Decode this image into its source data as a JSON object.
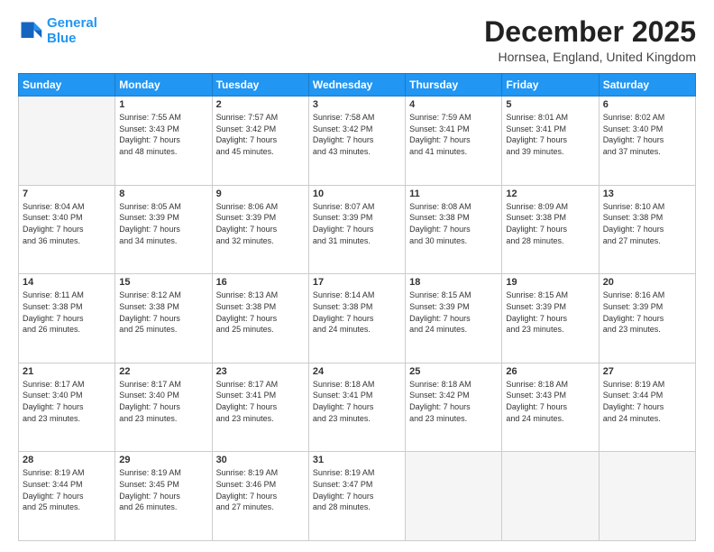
{
  "header": {
    "logo_line1": "General",
    "logo_line2": "Blue",
    "title": "December 2025",
    "subtitle": "Hornsea, England, United Kingdom"
  },
  "calendar": {
    "days_of_week": [
      "Sunday",
      "Monday",
      "Tuesday",
      "Wednesday",
      "Thursday",
      "Friday",
      "Saturday"
    ],
    "weeks": [
      [
        {
          "day": "",
          "info": ""
        },
        {
          "day": "1",
          "info": "Sunrise: 7:55 AM\nSunset: 3:43 PM\nDaylight: 7 hours\nand 48 minutes."
        },
        {
          "day": "2",
          "info": "Sunrise: 7:57 AM\nSunset: 3:42 PM\nDaylight: 7 hours\nand 45 minutes."
        },
        {
          "day": "3",
          "info": "Sunrise: 7:58 AM\nSunset: 3:42 PM\nDaylight: 7 hours\nand 43 minutes."
        },
        {
          "day": "4",
          "info": "Sunrise: 7:59 AM\nSunset: 3:41 PM\nDaylight: 7 hours\nand 41 minutes."
        },
        {
          "day": "5",
          "info": "Sunrise: 8:01 AM\nSunset: 3:41 PM\nDaylight: 7 hours\nand 39 minutes."
        },
        {
          "day": "6",
          "info": "Sunrise: 8:02 AM\nSunset: 3:40 PM\nDaylight: 7 hours\nand 37 minutes."
        }
      ],
      [
        {
          "day": "7",
          "info": "Sunrise: 8:04 AM\nSunset: 3:40 PM\nDaylight: 7 hours\nand 36 minutes."
        },
        {
          "day": "8",
          "info": "Sunrise: 8:05 AM\nSunset: 3:39 PM\nDaylight: 7 hours\nand 34 minutes."
        },
        {
          "day": "9",
          "info": "Sunrise: 8:06 AM\nSunset: 3:39 PM\nDaylight: 7 hours\nand 32 minutes."
        },
        {
          "day": "10",
          "info": "Sunrise: 8:07 AM\nSunset: 3:39 PM\nDaylight: 7 hours\nand 31 minutes."
        },
        {
          "day": "11",
          "info": "Sunrise: 8:08 AM\nSunset: 3:38 PM\nDaylight: 7 hours\nand 30 minutes."
        },
        {
          "day": "12",
          "info": "Sunrise: 8:09 AM\nSunset: 3:38 PM\nDaylight: 7 hours\nand 28 minutes."
        },
        {
          "day": "13",
          "info": "Sunrise: 8:10 AM\nSunset: 3:38 PM\nDaylight: 7 hours\nand 27 minutes."
        }
      ],
      [
        {
          "day": "14",
          "info": "Sunrise: 8:11 AM\nSunset: 3:38 PM\nDaylight: 7 hours\nand 26 minutes."
        },
        {
          "day": "15",
          "info": "Sunrise: 8:12 AM\nSunset: 3:38 PM\nDaylight: 7 hours\nand 25 minutes."
        },
        {
          "day": "16",
          "info": "Sunrise: 8:13 AM\nSunset: 3:38 PM\nDaylight: 7 hours\nand 25 minutes."
        },
        {
          "day": "17",
          "info": "Sunrise: 8:14 AM\nSunset: 3:38 PM\nDaylight: 7 hours\nand 24 minutes."
        },
        {
          "day": "18",
          "info": "Sunrise: 8:15 AM\nSunset: 3:39 PM\nDaylight: 7 hours\nand 24 minutes."
        },
        {
          "day": "19",
          "info": "Sunrise: 8:15 AM\nSunset: 3:39 PM\nDaylight: 7 hours\nand 23 minutes."
        },
        {
          "day": "20",
          "info": "Sunrise: 8:16 AM\nSunset: 3:39 PM\nDaylight: 7 hours\nand 23 minutes."
        }
      ],
      [
        {
          "day": "21",
          "info": "Sunrise: 8:17 AM\nSunset: 3:40 PM\nDaylight: 7 hours\nand 23 minutes."
        },
        {
          "day": "22",
          "info": "Sunrise: 8:17 AM\nSunset: 3:40 PM\nDaylight: 7 hours\nand 23 minutes."
        },
        {
          "day": "23",
          "info": "Sunrise: 8:17 AM\nSunset: 3:41 PM\nDaylight: 7 hours\nand 23 minutes."
        },
        {
          "day": "24",
          "info": "Sunrise: 8:18 AM\nSunset: 3:41 PM\nDaylight: 7 hours\nand 23 minutes."
        },
        {
          "day": "25",
          "info": "Sunrise: 8:18 AM\nSunset: 3:42 PM\nDaylight: 7 hours\nand 23 minutes."
        },
        {
          "day": "26",
          "info": "Sunrise: 8:18 AM\nSunset: 3:43 PM\nDaylight: 7 hours\nand 24 minutes."
        },
        {
          "day": "27",
          "info": "Sunrise: 8:19 AM\nSunset: 3:44 PM\nDaylight: 7 hours\nand 24 minutes."
        }
      ],
      [
        {
          "day": "28",
          "info": "Sunrise: 8:19 AM\nSunset: 3:44 PM\nDaylight: 7 hours\nand 25 minutes."
        },
        {
          "day": "29",
          "info": "Sunrise: 8:19 AM\nSunset: 3:45 PM\nDaylight: 7 hours\nand 26 minutes."
        },
        {
          "day": "30",
          "info": "Sunrise: 8:19 AM\nSunset: 3:46 PM\nDaylight: 7 hours\nand 27 minutes."
        },
        {
          "day": "31",
          "info": "Sunrise: 8:19 AM\nSunset: 3:47 PM\nDaylight: 7 hours\nand 28 minutes."
        },
        {
          "day": "",
          "info": ""
        },
        {
          "day": "",
          "info": ""
        },
        {
          "day": "",
          "info": ""
        }
      ]
    ]
  }
}
